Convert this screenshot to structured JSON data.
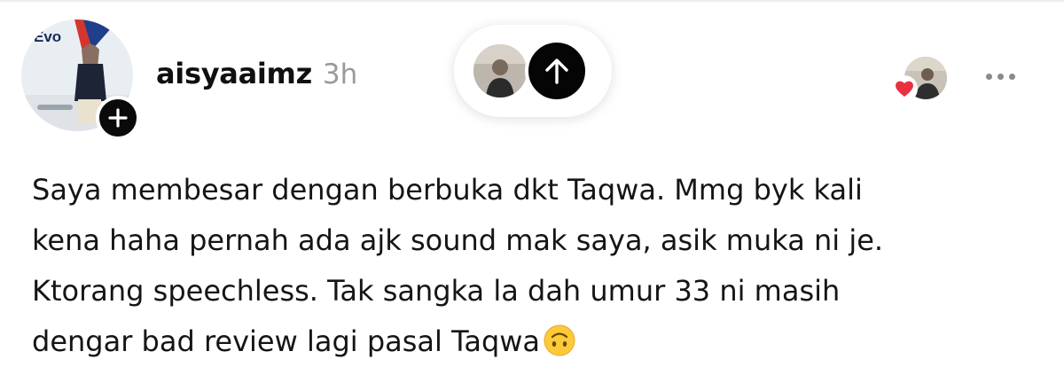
{
  "post": {
    "author": {
      "username": "aisyaaimz",
      "time": "3h",
      "avatar_logo_text": "Evo"
    },
    "body_lines": [
      "Saya membesar dengan berbuka dkt Taqwa. Mmg byk kali",
      "kena haha pernah ada ajk sound mak saya, asik muka ni je.",
      "Ktorang speechless. Tak sangka la dah umur 33 ni masih",
      "dengar bad review lagi pasal Taqwa"
    ],
    "trailing_emoji": "upside-down-face-emoji"
  },
  "icons": {
    "follow": "plus-icon",
    "scroll_top": "arrow-up-icon",
    "like": "heart-icon",
    "more": "more-dots-icon"
  },
  "colors": {
    "text": "#151515",
    "muted": "#9a9a9a",
    "heart": "#e8303f",
    "badge": "#0a0a0a"
  }
}
